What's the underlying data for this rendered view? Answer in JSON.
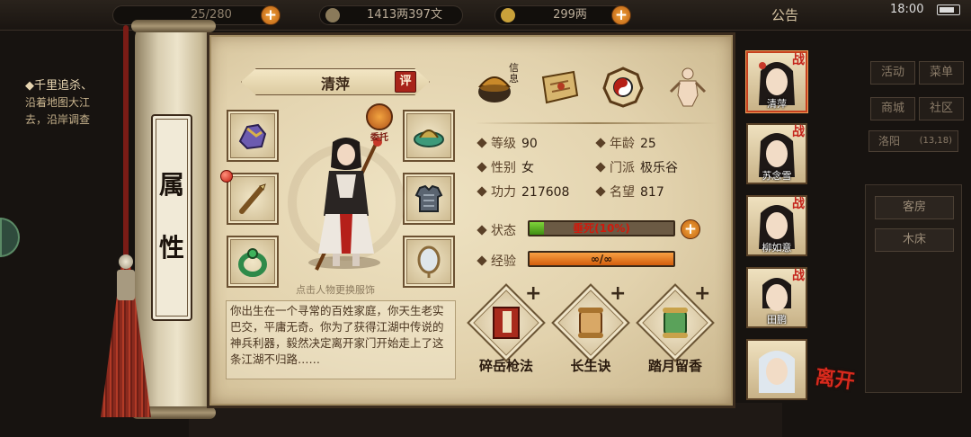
{
  "topbar": {
    "life_text": "25/280",
    "coins_text": "1413两397文",
    "money_text": "299两",
    "notice_label": "公告",
    "clock": "18:00"
  },
  "quest": {
    "title": "千里追杀、",
    "line1": "沿着地图大江",
    "line2": "去，沿岸调查"
  },
  "side_menu": {
    "activity": "活动",
    "menu": "菜单",
    "shop": "商城",
    "community": "社区",
    "location": "洛阳",
    "coords": "(13,18)",
    "places": [
      "客房",
      "木床"
    ]
  },
  "panel": {
    "title_chars": [
      "属",
      "性"
    ],
    "char_name": "清萍",
    "eval_label": "评",
    "entrust_label": "委托",
    "hint": "点击人物更换服饰",
    "bio": "你出生在一个寻常的百姓家庭，你天生老实巴交，平庸无奇。你为了获得江湖中传说的神兵利器，毅然决定离开家门开始走上了这条江湖不归路……",
    "xinshi_label": "信息"
  },
  "stats": {
    "level_label": "等级",
    "level": "90",
    "age_label": "年龄",
    "age": "25",
    "gender_label": "性别",
    "gender": "女",
    "sect_label": "门派",
    "sect": "极乐谷",
    "power_label": "功力",
    "power": "217608",
    "fame_label": "名望",
    "fame": "817",
    "status_label": "状态",
    "status_text": "垂死(10%)",
    "status_percent": 10,
    "exp_label": "经验",
    "exp_text": "∞/∞"
  },
  "skills": [
    {
      "name": "碎岳枪法"
    },
    {
      "name": "长生诀"
    },
    {
      "name": "踏月留香"
    }
  ],
  "party": [
    {
      "name": "清萍",
      "tag": "战",
      "active": true
    },
    {
      "name": "苏念雪",
      "tag": "战",
      "active": false
    },
    {
      "name": "柳如意",
      "tag": "战",
      "active": false
    },
    {
      "name": "田鹏",
      "tag": "战",
      "active": false
    },
    {
      "name": "",
      "tag": "",
      "active": false
    }
  ],
  "leave_label": "离开",
  "colors": {
    "accent_red": "#c4231a",
    "status_green": "#5fb526",
    "exp_orange": "#e8761c",
    "parchment": "#e6d6b2"
  }
}
